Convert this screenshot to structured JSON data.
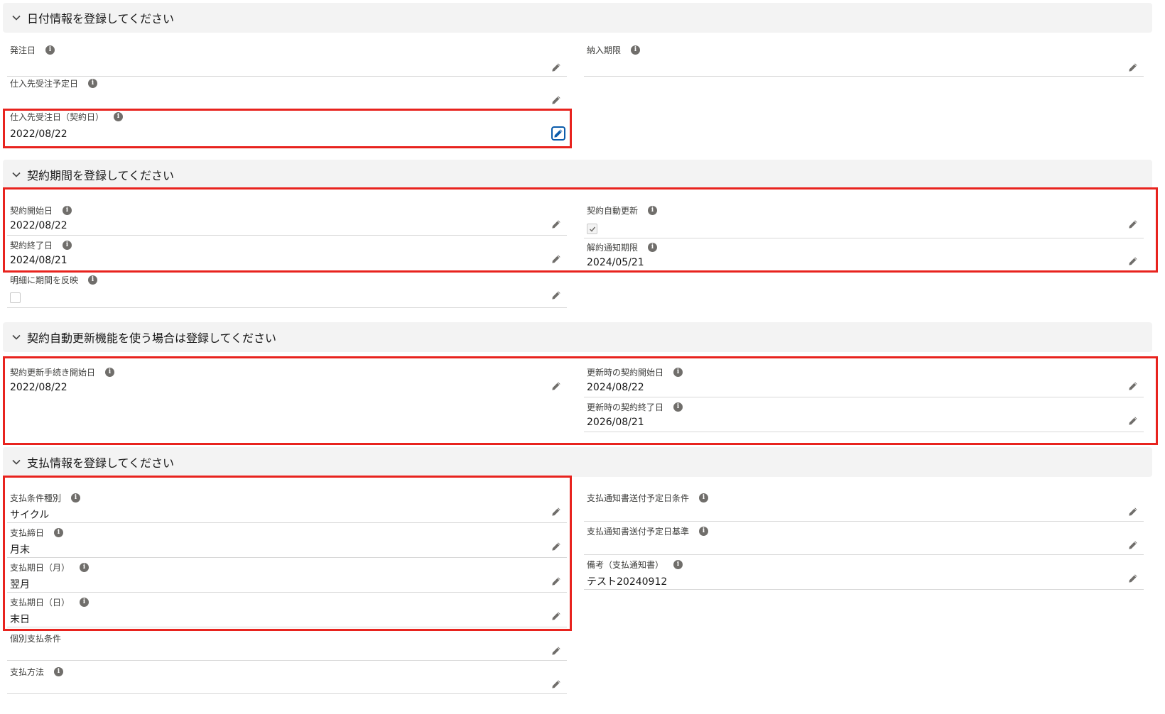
{
  "sections": {
    "dates": {
      "title": "日付情報を登録してください"
    },
    "contract_period": {
      "title": "契約期間を登録してください"
    },
    "auto_renewal": {
      "title": "契約自動更新機能を使う場合は登録してください"
    },
    "payment": {
      "title": "支払情報を登録してください"
    }
  },
  "fields": {
    "order_date": {
      "label": "発注日",
      "value": ""
    },
    "delivery_deadline": {
      "label": "納入期限",
      "value": ""
    },
    "supplier_order_planned_date": {
      "label": "仕入先受注予定日",
      "value": ""
    },
    "supplier_order_date": {
      "label": "仕入先受注日（契約日）",
      "value": "2022/08/22"
    },
    "contract_start_date": {
      "label": "契約開始日",
      "value": "2022/08/22"
    },
    "contract_auto_renewal": {
      "label": "契約自動更新",
      "checked": true
    },
    "contract_end_date": {
      "label": "契約終了日",
      "value": "2024/08/21"
    },
    "cancellation_notice_deadline": {
      "label": "解約通知期限",
      "value": "2024/05/21"
    },
    "reflect_period_to_details": {
      "label": "明細に期間を反映",
      "checked": false
    },
    "renewal_procedure_start_date": {
      "label": "契約更新手続き開始日",
      "value": "2022/08/22"
    },
    "renewal_contract_start_date": {
      "label": "更新時の契約開始日",
      "value": "2024/08/22"
    },
    "renewal_contract_end_date": {
      "label": "更新時の契約終了日",
      "value": "2026/08/21"
    },
    "payment_terms_type": {
      "label": "支払条件種別",
      "value": "サイクル"
    },
    "payment_notice_send_condition": {
      "label": "支払通知書送付予定日条件",
      "value": ""
    },
    "payment_closing_date": {
      "label": "支払締日",
      "value": "月末"
    },
    "payment_notice_send_basis": {
      "label": "支払通知書送付予定日基準",
      "value": ""
    },
    "payment_due_month": {
      "label": "支払期日（月）",
      "value": "翌月"
    },
    "remarks_payment_notice": {
      "label": "備考（支払通知書）",
      "value": "テスト20240912"
    },
    "payment_due_day": {
      "label": "支払期日（日）",
      "value": "末日"
    },
    "individual_payment_terms": {
      "label": "個別支払条件",
      "value": ""
    },
    "payment_method": {
      "label": "支払方法",
      "value": ""
    }
  },
  "colors": {
    "highlight": "#e8231e",
    "focus": "#0b5cab",
    "header_bg": "#f3f3f3"
  }
}
